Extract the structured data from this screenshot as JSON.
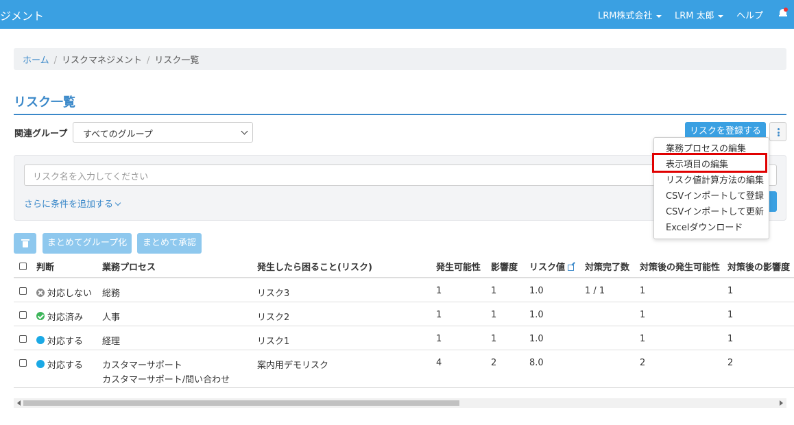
{
  "header": {
    "app_title": "ジメント",
    "company": "LRM株式会社",
    "user": "LRM 太郎",
    "help": "ヘルプ"
  },
  "breadcrumb": {
    "home": "ホーム",
    "section": "リスクマネジメント",
    "current": "リスク一覧"
  },
  "page": {
    "title": "リスク一覧"
  },
  "filter": {
    "group_label": "関連グループ",
    "group_value": "すべてのグループ",
    "register_button": "リスクを登録する"
  },
  "search": {
    "placeholder": "リスク名を入力してください",
    "add_condition": "さらに条件を追加する"
  },
  "actions": {
    "group_button": "まとめてグループ化",
    "approve_button": "まとめて承認"
  },
  "dropdown": {
    "items": [
      "業務プロセスの編集",
      "表示項目の編集",
      "リスク値計算方法の編集",
      "CSVインポートして登録",
      "CSVインポートして更新",
      "Excelダウンロード"
    ]
  },
  "table": {
    "headers": {
      "judgment": "判断",
      "process": "業務プロセス",
      "risk": "発生したら困ること(リスク)",
      "probability": "発生可能性",
      "impact": "影響度",
      "risk_value": "リスク値",
      "completed": "対策完了数",
      "post_probability": "対策後の発生可能性",
      "post_impact": "対策後の影響度"
    },
    "rows": [
      {
        "status": "対応しない",
        "status_type": "none",
        "process": "総務",
        "process2": "",
        "risk": "リスク3",
        "probability": "1",
        "impact": "1",
        "risk_value": "1.0",
        "completed": "1 / 1",
        "post_probability": "1",
        "post_impact": "1"
      },
      {
        "status": "対応済み",
        "status_type": "done",
        "process": "人事",
        "process2": "",
        "risk": "リスク2",
        "probability": "1",
        "impact": "1",
        "risk_value": "1.0",
        "completed": "",
        "post_probability": "1",
        "post_impact": "1"
      },
      {
        "status": "対応する",
        "status_type": "todo",
        "process": "経理",
        "process2": "",
        "risk": "リスク1",
        "probability": "1",
        "impact": "1",
        "risk_value": "1.0",
        "completed": "",
        "post_probability": "1",
        "post_impact": "1"
      },
      {
        "status": "対応する",
        "status_type": "todo",
        "process": "カスタマーサポート",
        "process2": "カスタマーサポート/問い合わせ",
        "risk": "案内用デモリスク",
        "probability": "4",
        "impact": "2",
        "risk_value": "8.0",
        "completed": "",
        "post_probability": "2",
        "post_impact": "2"
      }
    ]
  },
  "colors": {
    "header_bg": "#3aa0e2",
    "accent": "#3a88c9",
    "highlight": "#e00000"
  }
}
